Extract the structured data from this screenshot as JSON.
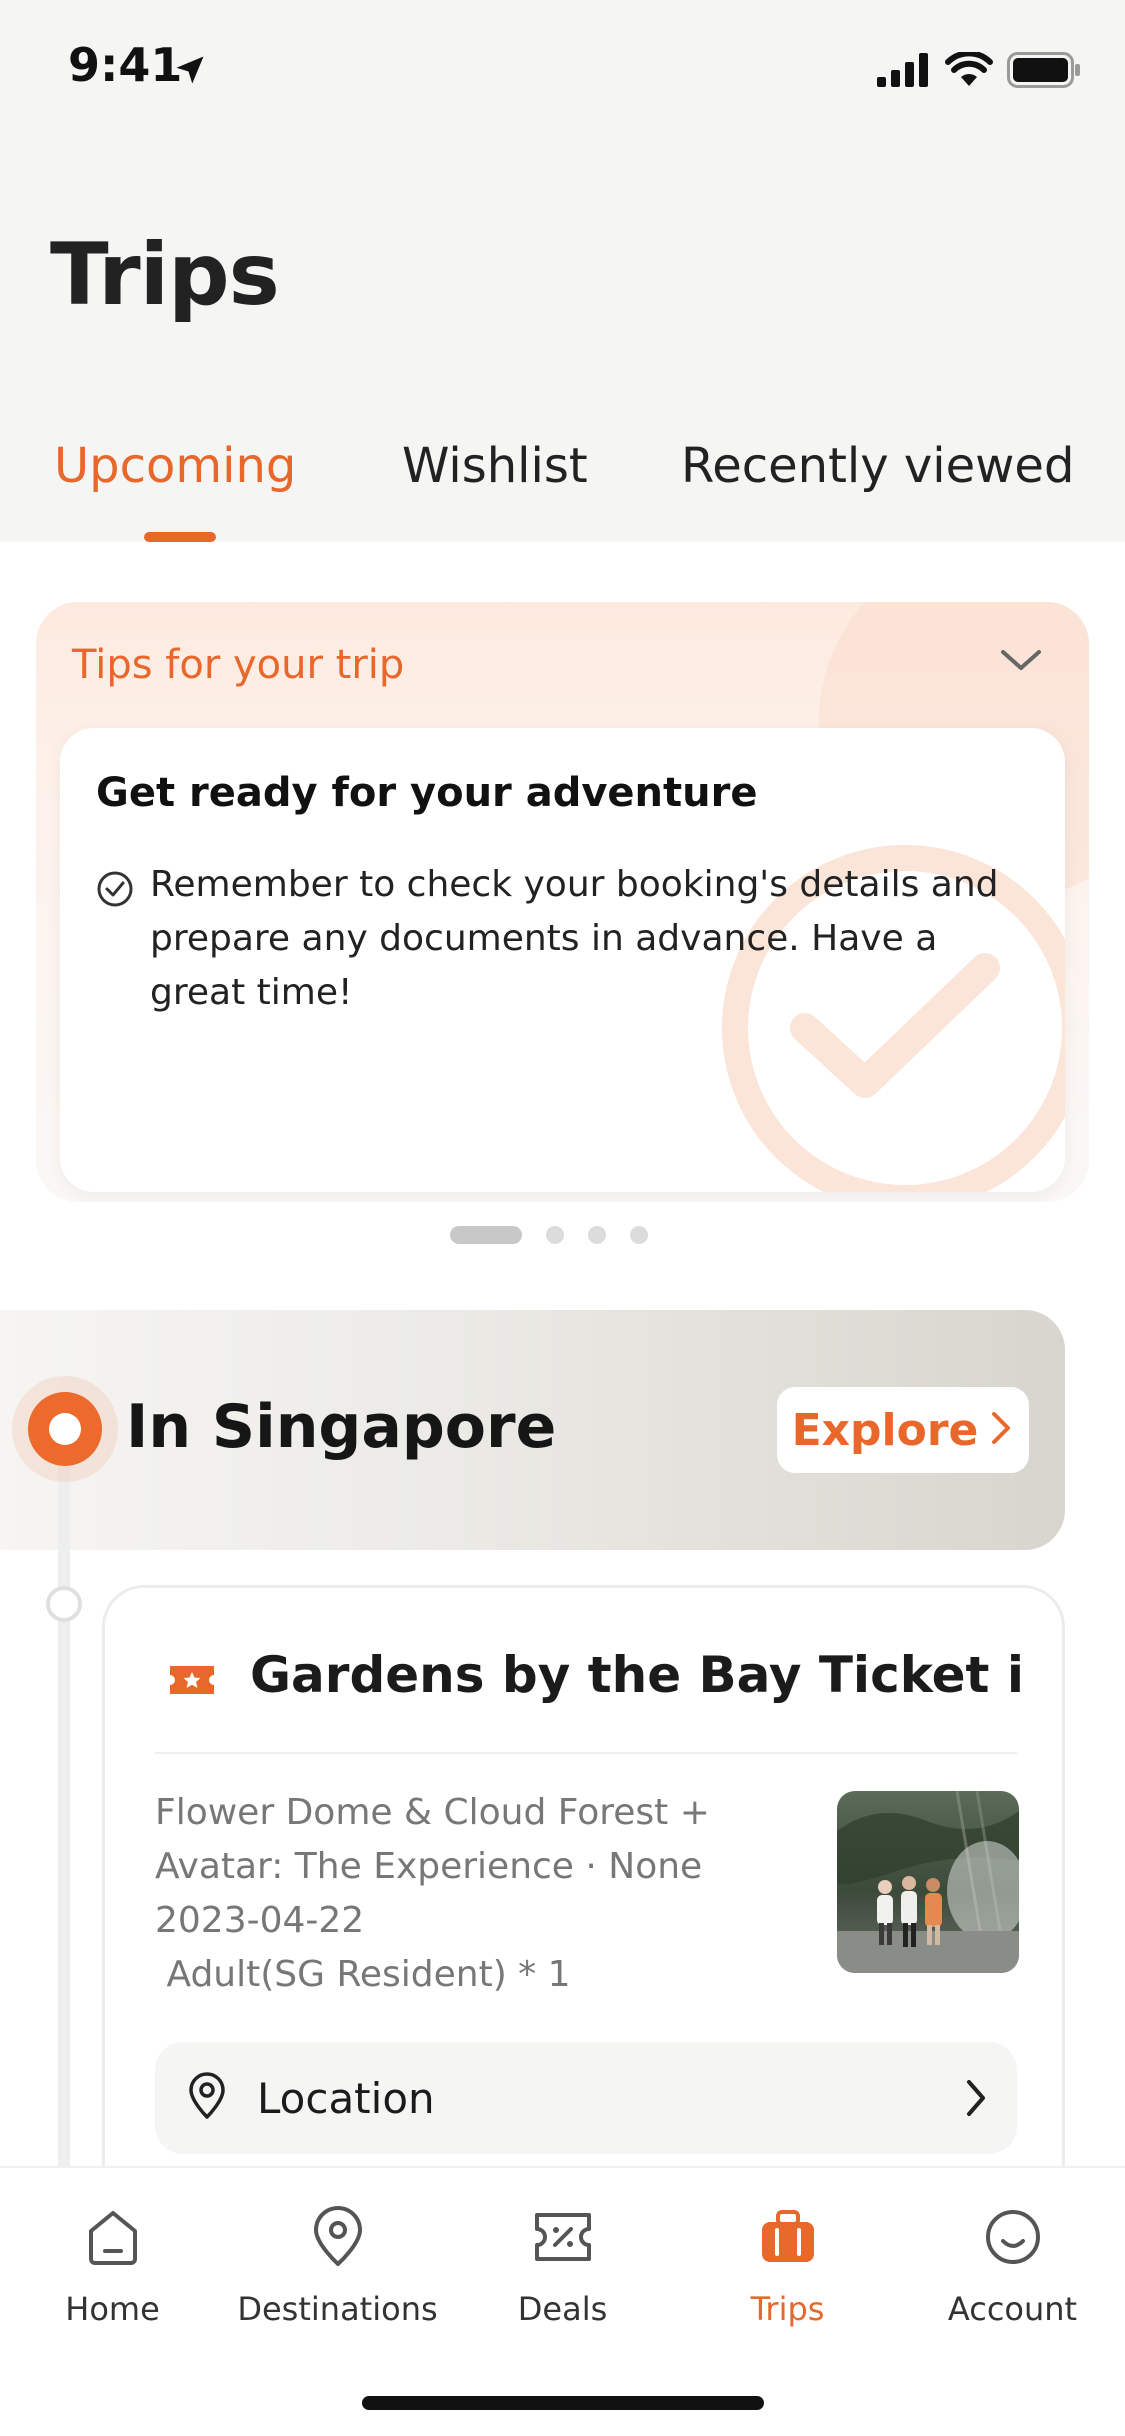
{
  "status_bar": {
    "time": "9:41"
  },
  "header": {
    "title": "Trips"
  },
  "tabs": [
    {
      "label": "Upcoming",
      "active": true
    },
    {
      "label": "Wishlist",
      "active": false
    },
    {
      "label": "Recently viewed",
      "active": false
    }
  ],
  "tips": {
    "header": "Tips for your trip",
    "card_title": "Get ready for your adventure",
    "card_text": "Remember to check your booking's details and prepare any documents in advance. Have a great time!",
    "page_count": 4,
    "active_page": 1
  },
  "city": {
    "name": "In Singapore",
    "explore_label": "Explore"
  },
  "booking": {
    "title": "Gardens by the Bay Ticket in ...",
    "details": [
      "Flower Dome & Cloud Forest +",
      "Avatar: The Experience · None",
      "2023-04-22",
      " Adult(SG Resident) * 1"
    ],
    "location_label": "Location"
  },
  "bottom_nav": [
    {
      "label": "Home",
      "icon": "home-icon"
    },
    {
      "label": "Destinations",
      "icon": "pin-icon"
    },
    {
      "label": "Deals",
      "icon": "coupon-icon"
    },
    {
      "label": "Trips",
      "icon": "suitcase-icon",
      "active": true
    },
    {
      "label": "Account",
      "icon": "smiley-icon"
    }
  ],
  "colors": {
    "accent": "#e8672a",
    "background": "#f5f5f3"
  }
}
